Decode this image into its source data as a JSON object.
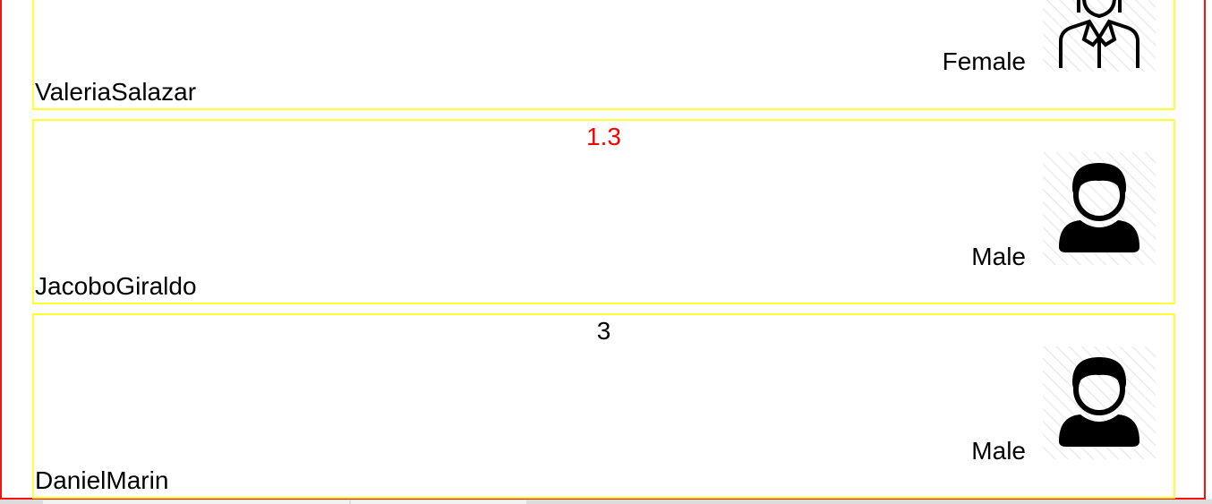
{
  "records": [
    {
      "score": "",
      "gender": "Female",
      "name": "ValeriaSalazar",
      "avatar_icon": "female-user-icon"
    },
    {
      "score": "1.3",
      "score_color": "#ff0000",
      "gender": "Male",
      "name": "JacoboGiraldo",
      "avatar_icon": "male-user-icon"
    },
    {
      "score": "3",
      "score_color": "#000000",
      "gender": "Male",
      "name": "DanielMarin",
      "avatar_icon": "male-user-icon"
    }
  ],
  "colors": {
    "frame_border": "#ff1010",
    "card_border": "#ffff33",
    "alert_text": "#ff0000"
  }
}
